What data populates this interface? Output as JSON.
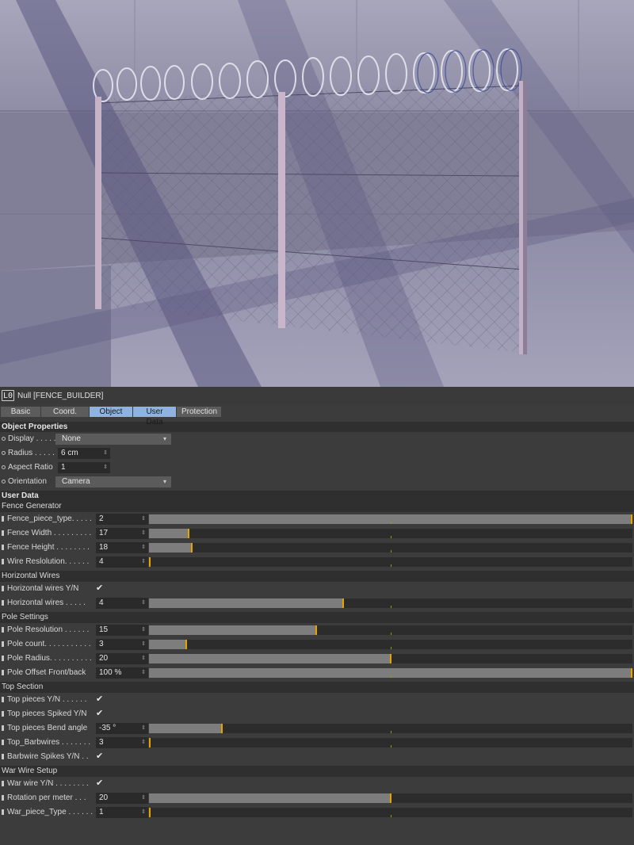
{
  "viewport": {
    "subject": "chain-link fence with razor wire render"
  },
  "object": {
    "icon": "L0",
    "title": "Null [FENCE_BUILDER]"
  },
  "tabs": [
    {
      "label": "Basic",
      "selected": false
    },
    {
      "label": "Coord.",
      "selected": false
    },
    {
      "label": "Object",
      "selected": true
    },
    {
      "label": "User Data",
      "selected": true
    },
    {
      "label": "Protection",
      "selected": false
    }
  ],
  "object_properties": {
    "heading": "Object Properties",
    "display": {
      "label": "Display . . . . .",
      "value": "None"
    },
    "radius": {
      "label": "Radius . . . . .",
      "value": "6 cm"
    },
    "aspect_ratio": {
      "label": "Aspect Ratio",
      "value": "1"
    },
    "orientation": {
      "label": "Orientation",
      "value": "Camera"
    }
  },
  "user_data": {
    "heading": "User Data",
    "fence_generator": {
      "heading": "Fence Generator",
      "fence_piece_type": {
        "label": "Fence_piece_type. . . . .",
        "value": "2",
        "fraction": 1.0
      },
      "fence_width": {
        "label": "Fence Width . . . . . . . . .",
        "value": "17",
        "fraction": 0.08
      },
      "fence_height": {
        "label": "Fence Height . . . . . . . .",
        "value": "18",
        "fraction": 0.087
      },
      "wire_resolution": {
        "label": "Wire Reslolution. . . . . .",
        "value": "4",
        "fraction": 0.0
      }
    },
    "horizontal_wires": {
      "heading": "Horizontal Wires",
      "wires_yn": {
        "label": "Horizontal wires Y/N",
        "checked": true
      },
      "wires": {
        "label": "Horizontal wires . . . . .",
        "value": "4",
        "fraction": 0.402
      }
    },
    "pole_settings": {
      "heading": "Pole Settings",
      "pole_resolution": {
        "label": "Pole Resolution . . . . . .",
        "value": "15",
        "fraction": 0.346
      },
      "pole_count": {
        "label": "Pole count. . . . . . . . . . .",
        "value": "3",
        "fraction": 0.076
      },
      "pole_radius": {
        "label": "Pole Radius. . . . . . . . . .",
        "value": "20",
        "fraction": 0.5
      },
      "pole_offset": {
        "label": "Pole Offset Front/back",
        "value": "100 %",
        "fraction": 1.0
      }
    },
    "top_section": {
      "heading": "Top Section",
      "top_pieces_yn": {
        "label": "Top pieces Y/N . . . . . .",
        "checked": true
      },
      "top_pieces_spiked": {
        "label": "Top pieces Spiked Y/N",
        "checked": true
      },
      "bend_angle": {
        "label": "Top pieces Bend angle",
        "value": "-35 °",
        "fraction": 0.149
      },
      "top_barbwires": {
        "label": "Top_Barbwires . . . . . . .",
        "value": "3",
        "fraction": 0.0
      },
      "barbwire_spikes": {
        "label": "Barbwire Spikes Y/N . .",
        "checked": true
      }
    },
    "war_wire": {
      "heading": "War Wire Setup",
      "war_wire_yn": {
        "label": "War wire Y/N . . . . . . . .",
        "checked": true
      },
      "rotation_per_meter": {
        "label": "Rotation per meter . . .",
        "value": "20",
        "fraction": 0.5
      },
      "war_piece_type": {
        "label": "War_piece_Type . . . . . .",
        "value": "1",
        "fraction": 0.0
      }
    }
  },
  "colors": {
    "panel": "#3c3c3c",
    "tab_selected": "#8fb3de",
    "slider_knob": "#e8a200"
  },
  "icons": {
    "spinner": "⇕",
    "dropdown": "▾",
    "check": "✔"
  }
}
